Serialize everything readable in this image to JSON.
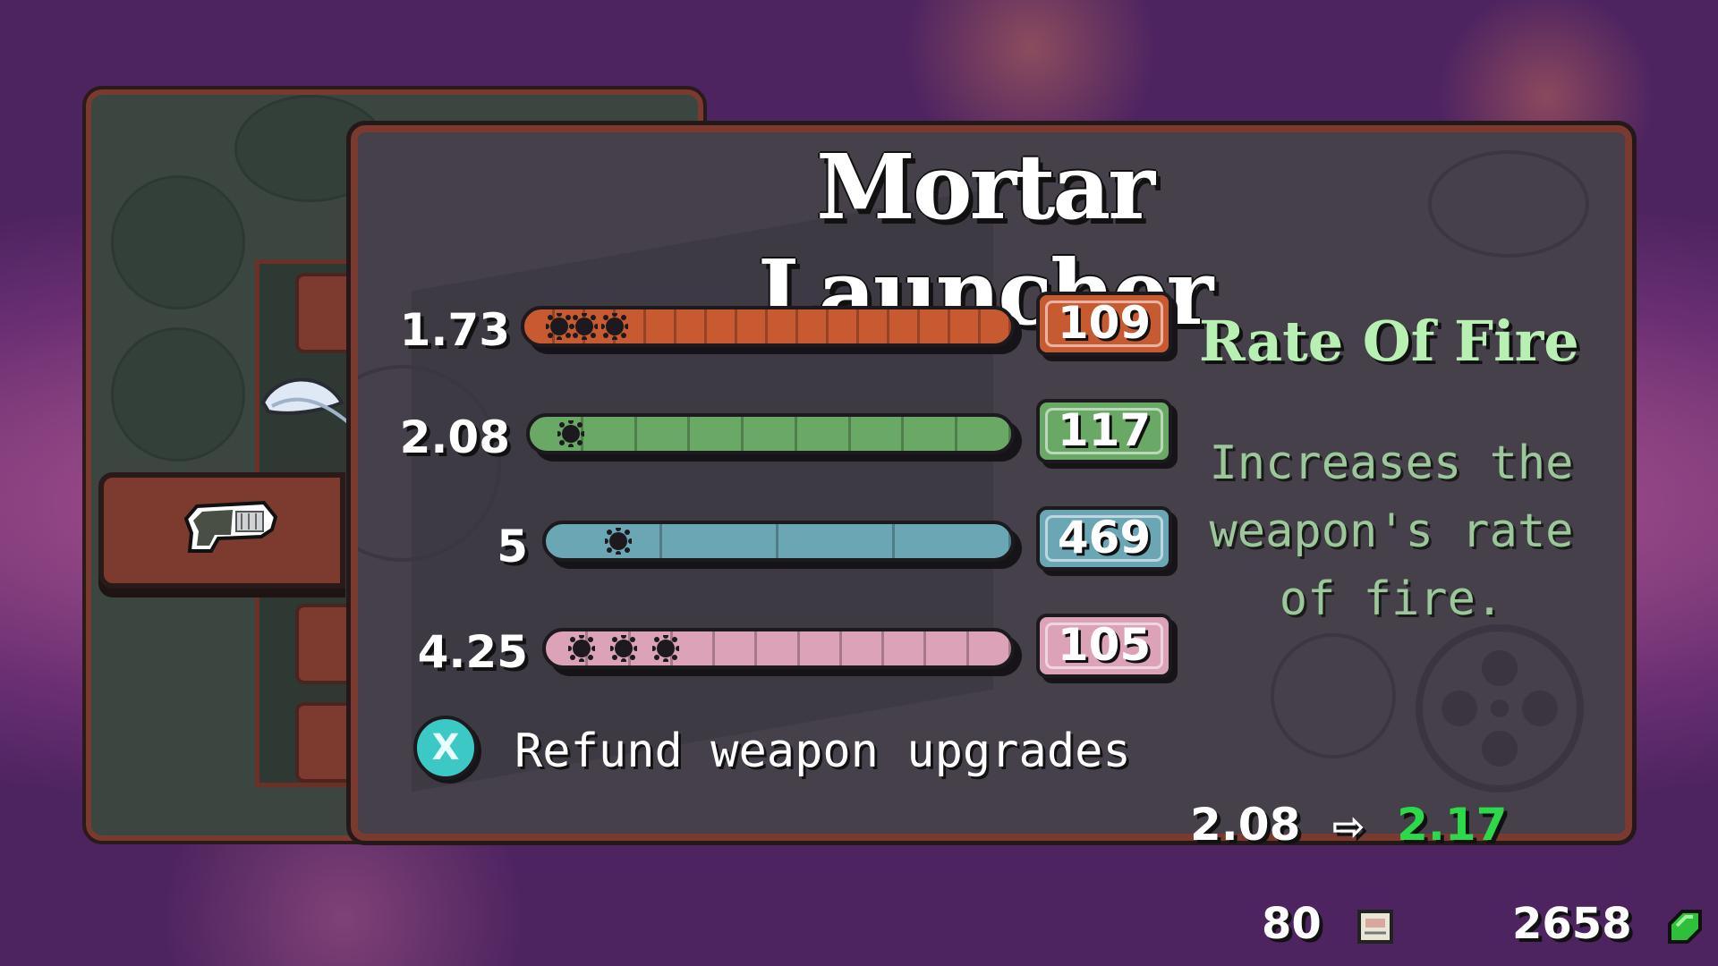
{
  "weapon": {
    "name": "Mortar Launcher"
  },
  "stats": [
    {
      "value": "1.73",
      "cost": "109",
      "color": "#c85a32",
      "segments": 16,
      "filled": 3
    },
    {
      "value": "2.08",
      "cost": "117",
      "color": "#6aa866",
      "segments": 9,
      "filled": 1
    },
    {
      "value": "5",
      "cost": "469",
      "color": "#6aa6b4",
      "segments": 4,
      "filled": 1
    },
    {
      "value": "4.25",
      "cost": "105",
      "color": "#dca2b8",
      "segments": 11,
      "filled": 3
    }
  ],
  "selected_stat": {
    "title": "Rate Of Fire",
    "description": "Increases the weapon's rate of fire.",
    "current": "2.08",
    "next": "2.17"
  },
  "refund": {
    "button": "X",
    "label": "Refund weapon upgrades"
  },
  "currency": [
    {
      "amount": "80",
      "icon": "scroll-icon"
    },
    {
      "amount": "2658",
      "icon": "green-gem-icon"
    }
  ],
  "icons": {
    "weapon": "mortar-launcher-icon",
    "equipped": "feather-icon"
  }
}
